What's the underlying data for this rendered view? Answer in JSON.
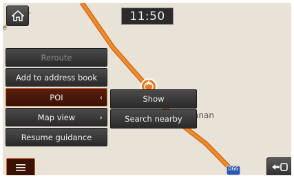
{
  "status": {
    "time": "11:50"
  },
  "map": {
    "place_label": "Hanan",
    "route_shield": "066",
    "colors": {
      "background": "#e8e3d6",
      "route": "#ee8a28",
      "route_edge": "#c9651a",
      "road": "#d9b46c"
    }
  },
  "menu": {
    "items": [
      {
        "label": "Reroute",
        "state": "disabled"
      },
      {
        "label": "Add to address book",
        "state": "normal"
      },
      {
        "label": "POI",
        "state": "selected",
        "arrow": "‹"
      },
      {
        "label": "Map view",
        "state": "normal",
        "arrow": "›"
      },
      {
        "label": "Resume guidance",
        "state": "normal"
      }
    ]
  },
  "submenu": {
    "items": [
      {
        "label": "Show"
      },
      {
        "label": "Search nearby"
      }
    ]
  },
  "icons": {
    "home": "home-icon",
    "menu": "menu-icon",
    "back": "back-icon",
    "position": "position-marker-icon"
  },
  "accent_color": "#c76a2a"
}
